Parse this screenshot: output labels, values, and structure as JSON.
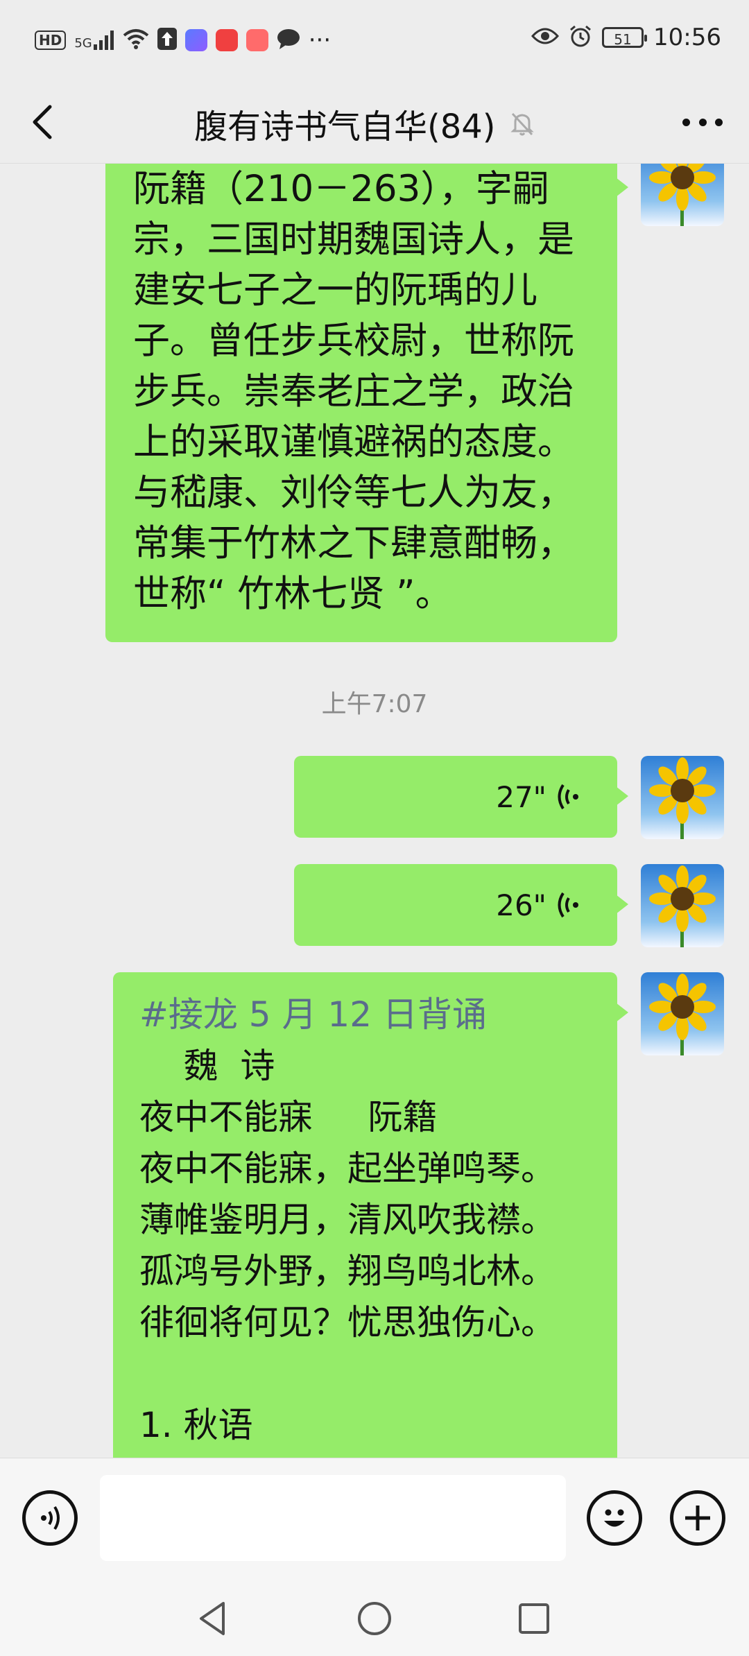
{
  "status_bar": {
    "network_badge": "HD",
    "network_gen": "5G",
    "battery": "51",
    "time": "10:56",
    "icons": [
      "hd-icon",
      "signal-icon",
      "wifi-icon",
      "upload-icon",
      "app-icon-blue",
      "app-icon-red",
      "app-icon-pink",
      "chat-bubble-icon",
      "more-dots-icon",
      "eye-icon",
      "alarm-icon",
      "battery-icon"
    ]
  },
  "nav": {
    "title": "腹有诗书气自华(84)",
    "back_icon": "chevron-left-icon",
    "mute_icon": "bell-off-icon",
    "more_icon": "more-dots-icon"
  },
  "messages": {
    "bio": {
      "lines": [
        "阮籍（210－263），字嗣",
        "宗，三国时期魏国诗人，是",
        "建安七子之一的阮瑀的儿",
        "子。曾任步兵校尉，世称阮",
        "步兵。崇奉老庄之学，政治",
        "上的采取谨慎避祸的态度。",
        "与嵇康、刘伶等七人为友，",
        "常集于竹林之下肆意酣畅，",
        "世称“ 竹林七贤 ”。"
      ]
    },
    "timestamp": "上午7:07",
    "voice1": {
      "duration": "27\""
    },
    "voice2": {
      "duration": "26\""
    },
    "poem": {
      "hashtag": "#接龙 5 月 12 日背诵",
      "lines": [
        "    魏  诗",
        "夜中不能寐     阮籍",
        "夜中不能寐，起坐弹鸣琴。",
        "薄帷鉴明月，清风吹我襟。",
        "孤鸿号外野，翔鸟鸣北林。",
        "徘徊将何见？忧思独伤心。",
        "",
        "1. 秋语"
      ]
    }
  },
  "input_bar": {
    "placeholder": "",
    "voice_icon": "voice-input-icon",
    "emoji_icon": "emoji-icon",
    "plus_icon": "plus-icon"
  },
  "system_nav": {
    "icons": [
      "back-triangle-icon",
      "home-circle-icon",
      "recents-square-icon"
    ]
  },
  "colors": {
    "bubble": "#95ec69",
    "background": "#ededed",
    "hashtag": "#5a6c8c"
  }
}
